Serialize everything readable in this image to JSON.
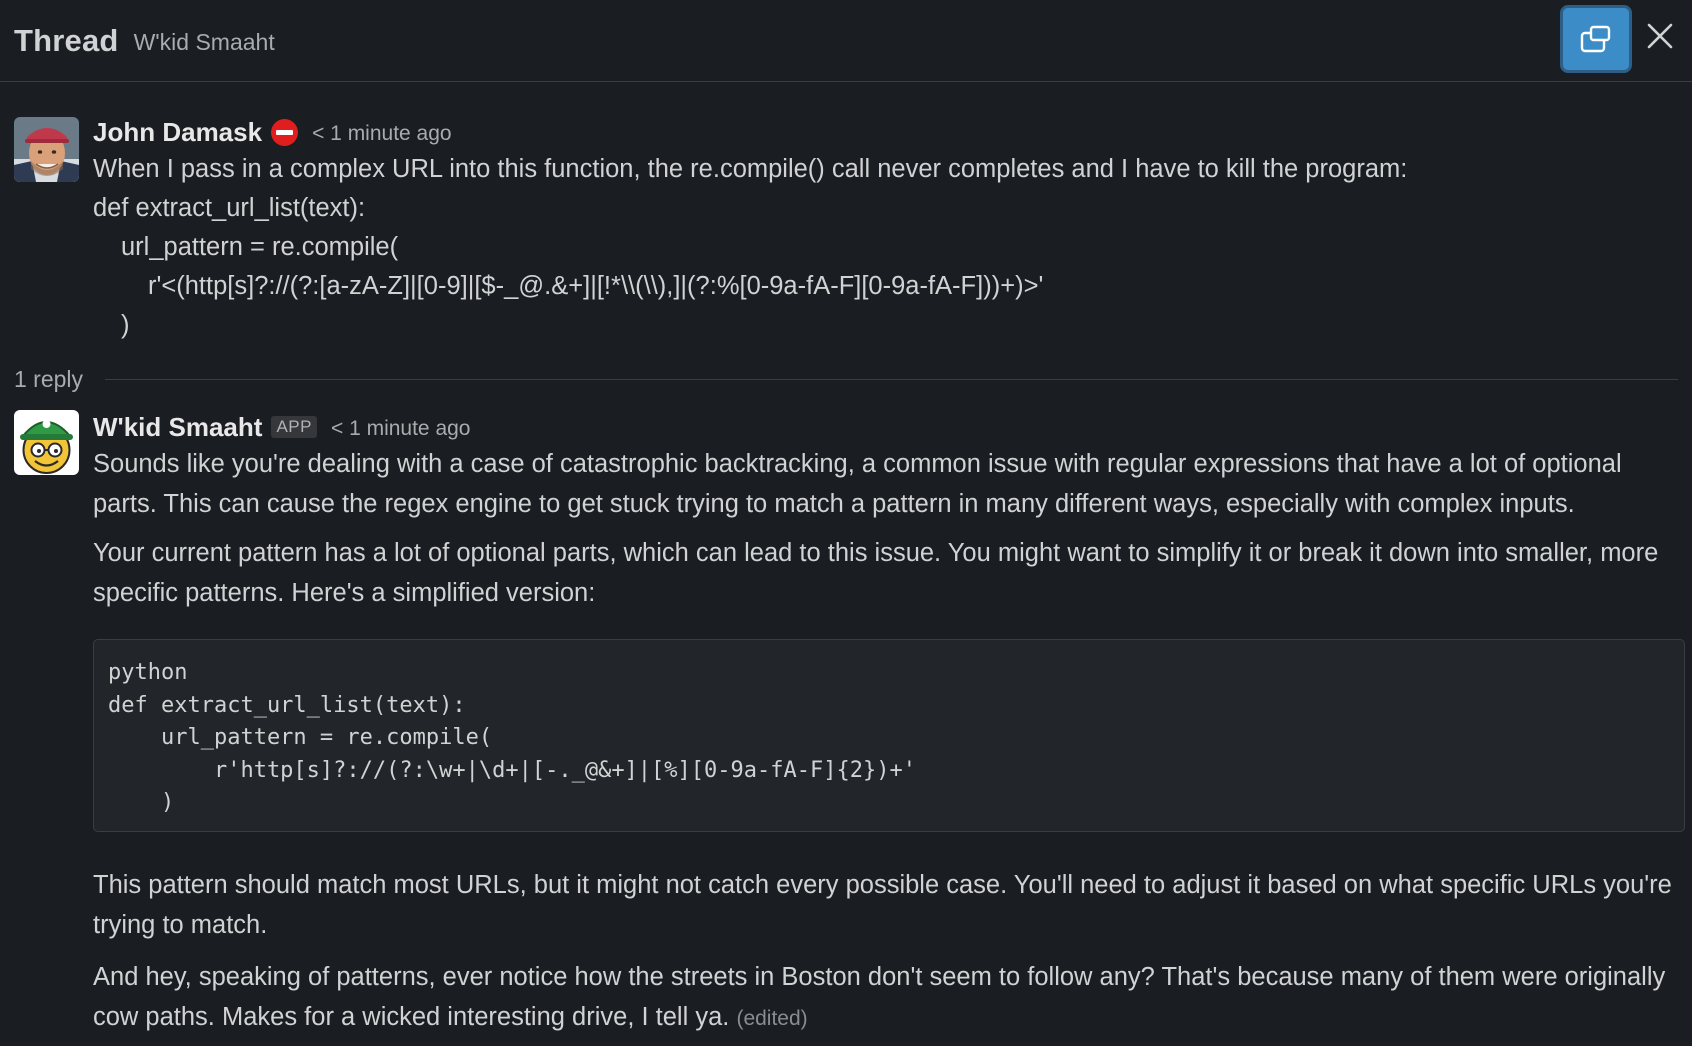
{
  "header": {
    "title": "Thread",
    "channel": "W'kid Smaaht"
  },
  "parent_message": {
    "author": "John Damask",
    "timestamp": "< 1 minute ago",
    "lines": [
      "When I pass in a complex URL into this function, the re.compile() call never completes and I have to kill the program:",
      "def extract_url_list(text):",
      "url_pattern = re.compile(",
      "r'<(http[s]?://(?:[a-zA-Z]|[0-9]|[$-_@.&+]|[!*\\\\(\\\\),]|(?:%[0-9a-fA-F][0-9a-fA-F]))+)>'",
      ")"
    ]
  },
  "replies": {
    "count_label": "1 reply"
  },
  "reply_message": {
    "author": "W'kid Smaaht",
    "badge": "APP",
    "timestamp": "< 1 minute ago",
    "paragraphs": [
      "Sounds like you're dealing with a case of catastrophic backtracking, a common issue with regular expressions that have a lot of optional parts. This can cause the regex engine to get stuck trying to match a pattern in many different ways, especially with complex inputs.",
      "Your current pattern has a lot of optional parts, which can lead to this issue. You might want to simplify it or break it down into smaller, more specific patterns. Here's a simplified version:"
    ],
    "code": "python\ndef extract_url_list(text):\n    url_pattern = re.compile(\n        r'http[s]?://(?:\\w+|\\d+|[-._@&+]|[%][0-9a-fA-F]{2})+'\n    )",
    "paragraphs_after": [
      "This pattern should match most URLs, but it might not catch every possible case. You'll need to adjust it based on what specific URLs you're trying to match.",
      "And hey, speaking of patterns, ever notice how the streets in Boston don't seem to follow any? That's because many of them were originally cow paths. Makes for a wicked interesting drive, I tell ya."
    ],
    "edited_label": "(edited)"
  },
  "icons": {
    "popout": "popout-window-icon",
    "close": "close-icon",
    "status": "no-entry-icon"
  },
  "colors": {
    "background": "#1a1d21",
    "accent": "#3c8dc7",
    "text": "#d1d2d3",
    "muted": "#a9abad",
    "status_red": "#e01e1e"
  }
}
